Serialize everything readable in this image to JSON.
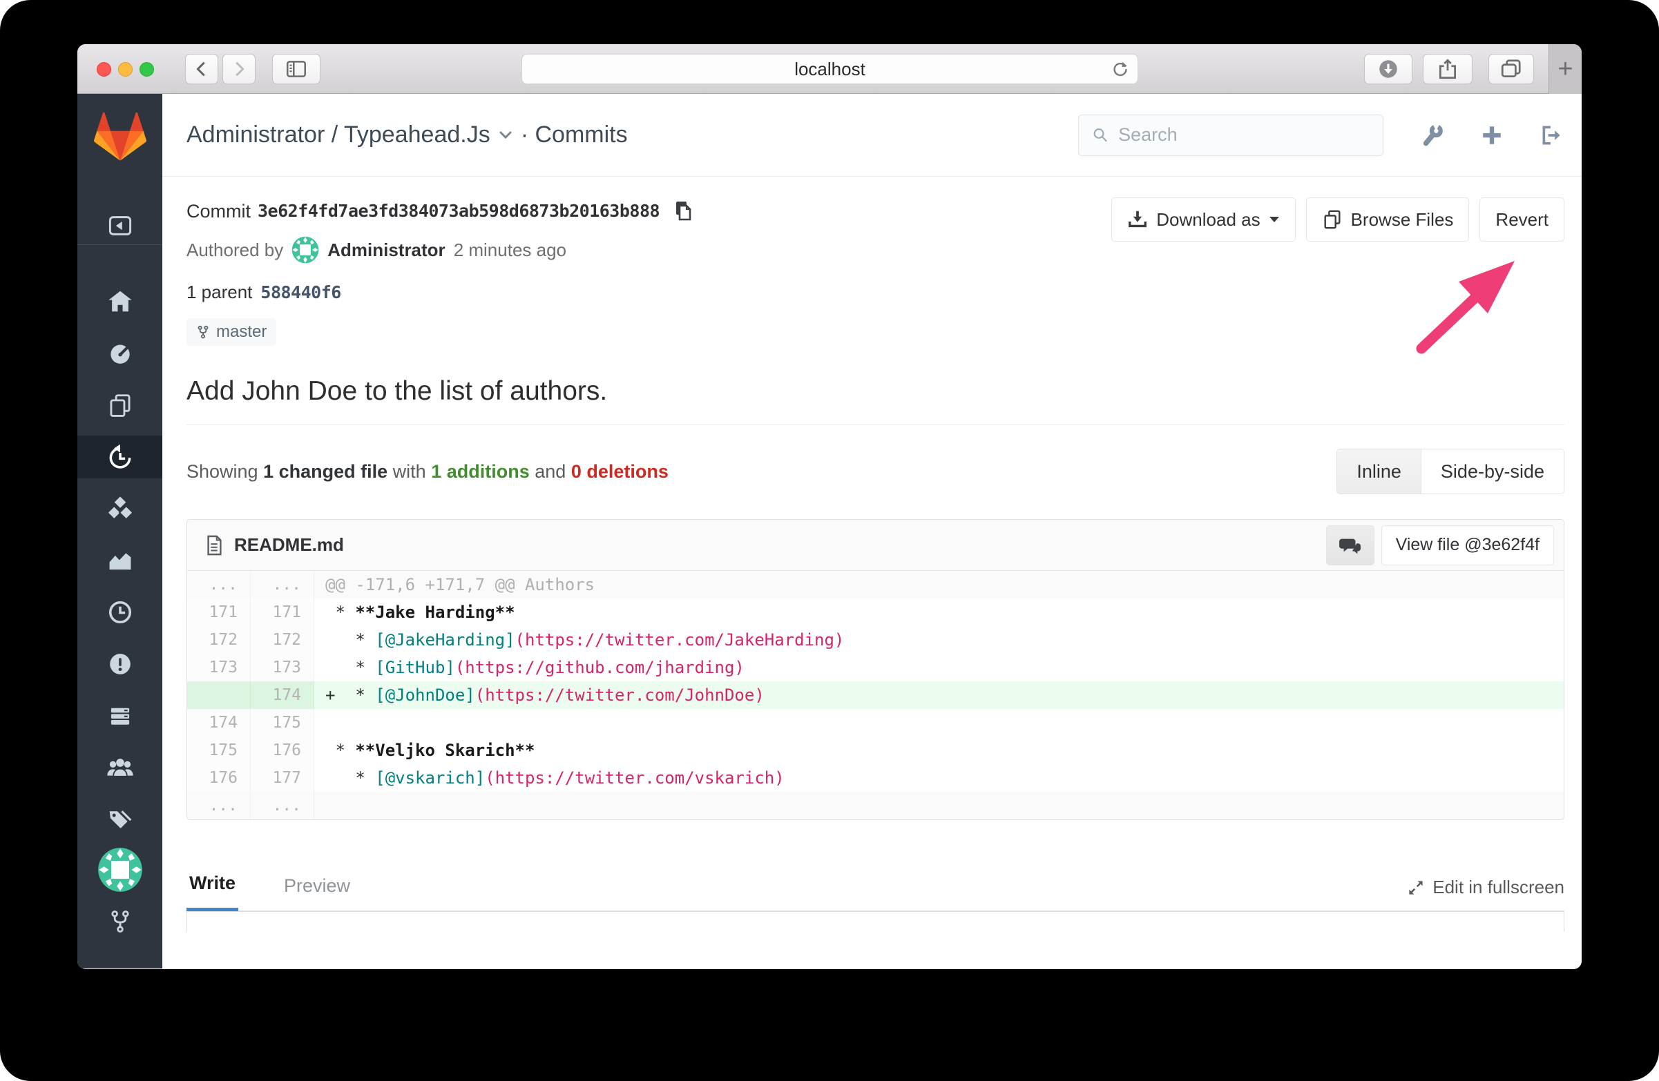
{
  "browser": {
    "url": "localhost",
    "new_tab_glyph": "+"
  },
  "header": {
    "title_project": "Administrator / Typeahead.Js",
    "title_rest": "· Commits",
    "search_placeholder": "Search"
  },
  "commit": {
    "label": "Commit",
    "sha": "3e62f4fd7ae3fd384073ab598d6873b20163b888",
    "authored_prefix": "Authored by",
    "author": "Administrator",
    "time": "2 minutes ago",
    "parent_label": "1 parent",
    "parent_sha": "588440f6",
    "branch": "master",
    "title": "Add John Doe to the list of authors.",
    "buttons": {
      "download": "Download as",
      "browse": "Browse Files",
      "revert": "Revert"
    }
  },
  "changes": {
    "showing_prefix": "Showing",
    "changed": "1 changed file",
    "with_label": "with",
    "additions": "1 additions",
    "and_label": "and",
    "deletions": "0 deletions",
    "toggle": {
      "inline": "Inline",
      "side": "Side-by-side"
    }
  },
  "diff": {
    "file": "README.md",
    "view_file": "View file @3e62f4f",
    "rows": [
      {
        "old": "...",
        "new": "...",
        "cls": "match",
        "segs": [
          {
            "t": "@@ -171,6 +171,7 @@ Authors",
            "c": "hunk"
          }
        ]
      },
      {
        "old": "171",
        "new": "171",
        "segs": [
          {
            "t": " * ",
            "c": "p"
          },
          {
            "t": "**Jake Harding**",
            "c": "b"
          }
        ]
      },
      {
        "old": "172",
        "new": "172",
        "segs": [
          {
            "t": "   * ",
            "c": "p"
          },
          {
            "t": "[@JakeHarding]",
            "c": "t"
          },
          {
            "t": "(https://twitter.com/JakeHarding)",
            "c": "r"
          }
        ]
      },
      {
        "old": "173",
        "new": "173",
        "segs": [
          {
            "t": "   * ",
            "c": "p"
          },
          {
            "t": "[GitHub]",
            "c": "t"
          },
          {
            "t": "(https://github.com/jharding)",
            "c": "r"
          }
        ]
      },
      {
        "old": "",
        "new": "174",
        "cls": "add",
        "segs": [
          {
            "t": "+  * ",
            "c": "p"
          },
          {
            "t": "[@JohnDoe]",
            "c": "t"
          },
          {
            "t": "(https://twitter.com/JohnDoe)",
            "c": "r"
          }
        ]
      },
      {
        "old": "174",
        "new": "175",
        "segs": []
      },
      {
        "old": "175",
        "new": "176",
        "segs": [
          {
            "t": " * ",
            "c": "p"
          },
          {
            "t": "**Veljko Skarich**",
            "c": "b"
          }
        ]
      },
      {
        "old": "176",
        "new": "177",
        "segs": [
          {
            "t": "   * ",
            "c": "p"
          },
          {
            "t": "[@vskarich]",
            "c": "t"
          },
          {
            "t": "(https://twitter.com/vskarich)",
            "c": "r"
          }
        ]
      },
      {
        "old": "...",
        "new": "...",
        "cls": "match",
        "segs": []
      }
    ]
  },
  "form": {
    "write": "Write",
    "preview": "Preview",
    "fullscreen": "Edit in fullscreen"
  },
  "accents": {
    "brand_red": "#e24329",
    "brand_orange": "#fc6d26",
    "brand_yellow": "#fca326",
    "additions_green": "#418e2f",
    "deletions_red": "#cf2a21",
    "link_teal": "#008080",
    "url_red": "#d6246a",
    "active_tab_blue": "#4285cb",
    "annotation_arrow_pink": "#ef3e76",
    "sidebar_bg": "#2e353e",
    "added_line_bg": "#ecfdf0"
  }
}
